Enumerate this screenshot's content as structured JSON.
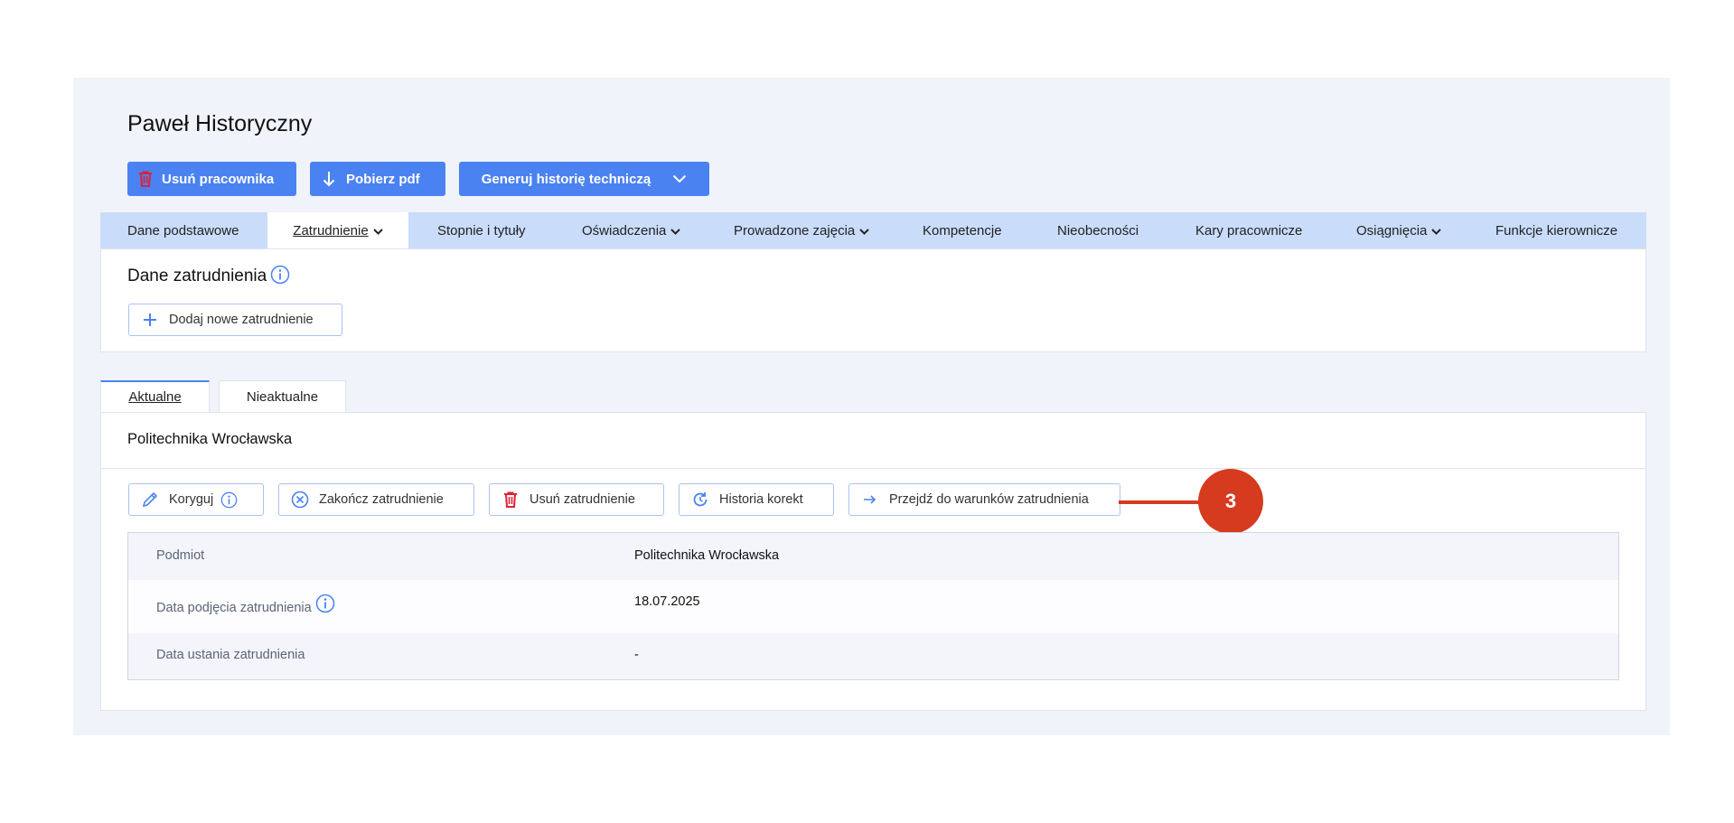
{
  "employee": {
    "name": "Paweł Historyczny"
  },
  "actions": {
    "delete_employee": "Usuń pracownika",
    "download_pdf": "Pobierz pdf",
    "generate_history": "Generuj historię techniczą"
  },
  "tabs": [
    {
      "label": "Dane podstawowe"
    },
    {
      "label": "Zatrudnienie"
    },
    {
      "label": "Stopnie i tytuły"
    },
    {
      "label": "Oświadczenia"
    },
    {
      "label": "Prowadzone zajęcia"
    },
    {
      "label": "Kompetencje"
    },
    {
      "label": "Nieobecności"
    },
    {
      "label": "Kary pracownicze"
    },
    {
      "label": "Osiągnięcia"
    },
    {
      "label": "Funkcje kierownicze"
    }
  ],
  "employment": {
    "section_title": "Dane zatrudnienia",
    "add_button": "Dodaj nowe zatrudnienie"
  },
  "subtabs": {
    "current": "Aktualne",
    "past": "Nieaktualne"
  },
  "record": {
    "company": "Politechnika Wrocławska",
    "buttons": {
      "correct": "Koryguj",
      "end": "Zakończ zatrudnienie",
      "delete": "Usuń zatrudnienie",
      "history": "Historia korekt",
      "goto_conditions": "Przejdź do warunków zatrudnienia"
    },
    "rows": [
      {
        "key": "Podmiot",
        "value": "Politechnika Wrocławska"
      },
      {
        "key": "Data podjęcia zatrudnienia",
        "value": "18.07.2025"
      },
      {
        "key": "Data ustania zatrudnienia",
        "value": "-"
      }
    ]
  },
  "callout": {
    "number": "3"
  },
  "colors": {
    "primary": "#4a82f1",
    "tab_bar": "#c9dcfa",
    "callout": "#d63a1f",
    "panel": "#f1f3fa"
  }
}
